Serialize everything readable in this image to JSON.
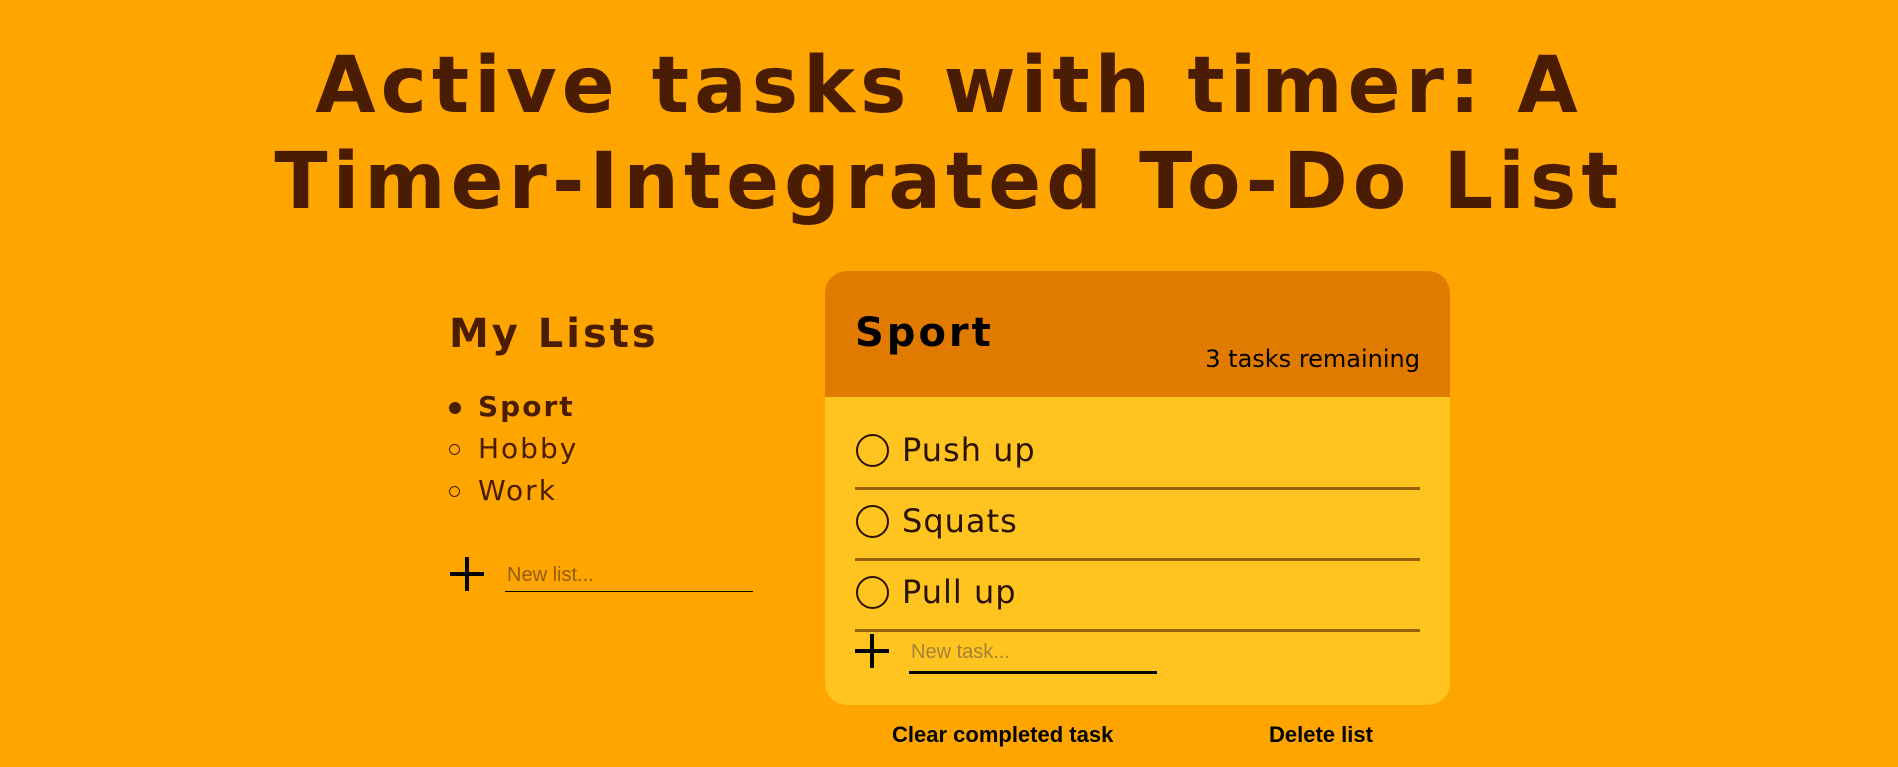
{
  "page": {
    "title_line1": "Active tasks with timer: A",
    "title_line2": "Timer-Integrated To-Do List"
  },
  "colors": {
    "background": "#FFA500",
    "card_header": "#E07B00",
    "card_body": "#FFC41F",
    "text_dark": "#4a1d02"
  },
  "sidebar": {
    "heading": "My Lists",
    "items": [
      {
        "label": "Sport",
        "active": true
      },
      {
        "label": "Hobby",
        "active": false
      },
      {
        "label": "Work",
        "active": false
      }
    ],
    "new_list_icon": "plus-icon",
    "new_list_placeholder": "New list..."
  },
  "todo": {
    "title": "Sport",
    "remaining": "3 tasks remaining",
    "tasks": [
      {
        "label": "Push up",
        "completed": false
      },
      {
        "label": "Squats",
        "completed": false
      },
      {
        "label": "Pull up",
        "completed": false
      }
    ],
    "new_task_icon": "plus-icon",
    "new_task_placeholder": "New task..."
  },
  "actions": {
    "clear_label": "Clear completed task",
    "delete_label": "Delete list"
  }
}
